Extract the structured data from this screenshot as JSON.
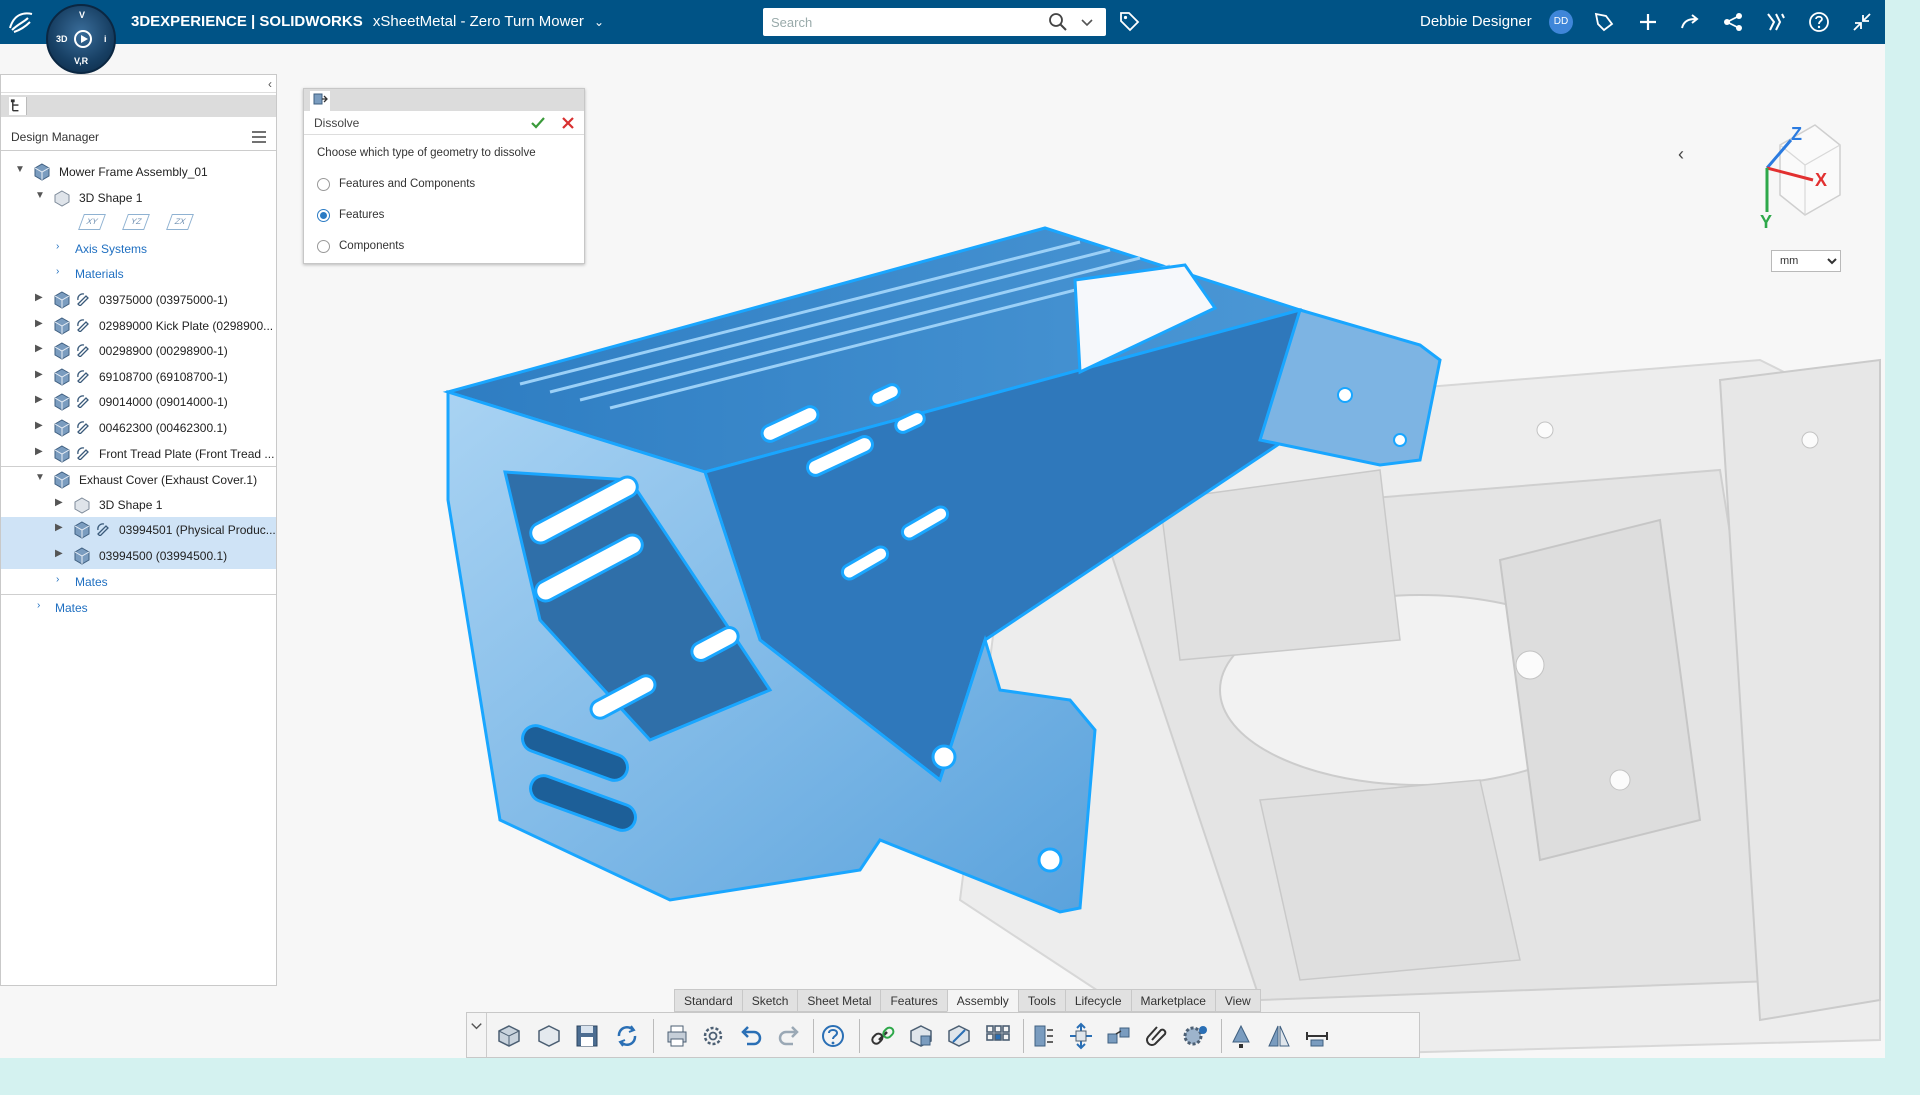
{
  "topbar": {
    "brand": "3DEXPERIENCE | SOLIDWORKS",
    "document_title": "xSheetMetal - Zero Turn Mower",
    "search_placeholder": "Search",
    "user_name": "Debbie Designer",
    "user_initials": "DD",
    "compass_labels": {
      "top": "V",
      "left": "3D",
      "right": "i",
      "bottom": "V,R"
    }
  },
  "left_panel": {
    "title": "Design Manager",
    "tree": [
      {
        "label": "Mower Frame Assembly_01"
      },
      {
        "label": "3D Shape 1"
      },
      {
        "plane_labels": [
          "XY",
          "YZ",
          "ZX"
        ]
      },
      {
        "label": "Axis Systems"
      },
      {
        "label": "Materials"
      },
      {
        "label": "03975000 (03975000-1)"
      },
      {
        "label": "02989000 Kick Plate (0298900..."
      },
      {
        "label": "00298900 (00298900-1)"
      },
      {
        "label": "69108700 (69108700-1)"
      },
      {
        "label": "09014000 (09014000-1)"
      },
      {
        "label": "00462300 (00462300.1)"
      },
      {
        "label": "Front Tread Plate (Front Tread ..."
      },
      {
        "label": "Exhaust Cover (Exhaust Cover.1)"
      },
      {
        "label": "3D Shape 1"
      },
      {
        "label": "03994501 (Physical Produc..."
      },
      {
        "label": "03994500 (03994500.1)"
      },
      {
        "label": "Mates"
      },
      {
        "label": "Mates"
      }
    ]
  },
  "dialog": {
    "title": "Dissolve",
    "prompt": "Choose which type of geometry to dissolve",
    "options": [
      {
        "label": "Features and Components",
        "selected": false
      },
      {
        "label": "Features",
        "selected": true
      },
      {
        "label": "Components",
        "selected": false
      }
    ]
  },
  "viewport": {
    "triad": {
      "x": "X",
      "y": "Y",
      "z": "Z"
    },
    "unit": "mm"
  },
  "toolbar": {
    "tabs": [
      "Standard",
      "Sketch",
      "Sheet Metal",
      "Features",
      "Assembly",
      "Tools",
      "Lifecycle",
      "Marketplace",
      "View"
    ],
    "active_tab": "Assembly",
    "tools": [
      "insert-part-icon",
      "new-part-icon",
      "save-icon",
      "rebuild-icon",
      "print-icon",
      "options-gear-icon",
      "undo-icon",
      "redo-icon",
      "help-icon",
      "link-chain-icon",
      "part-icon-1",
      "part-icon-2",
      "pattern-icon",
      "flexible-icon",
      "move-component-icon",
      "explode-icon",
      "paperclip-icon",
      "gear-assembly-icon",
      "fastener-icon",
      "mirror-icon",
      "measure-icon"
    ]
  },
  "colors": {
    "topbar": "#005386",
    "accent": "#1a9ee8",
    "model_fill": "#3f8fd3",
    "avatar": "#3f86d9",
    "triad_x": "#e23030",
    "triad_y": "#2ea84a",
    "triad_z": "#2b7be0",
    "dialog_ok": "#3a9a3a",
    "dialog_close": "#d83030"
  }
}
